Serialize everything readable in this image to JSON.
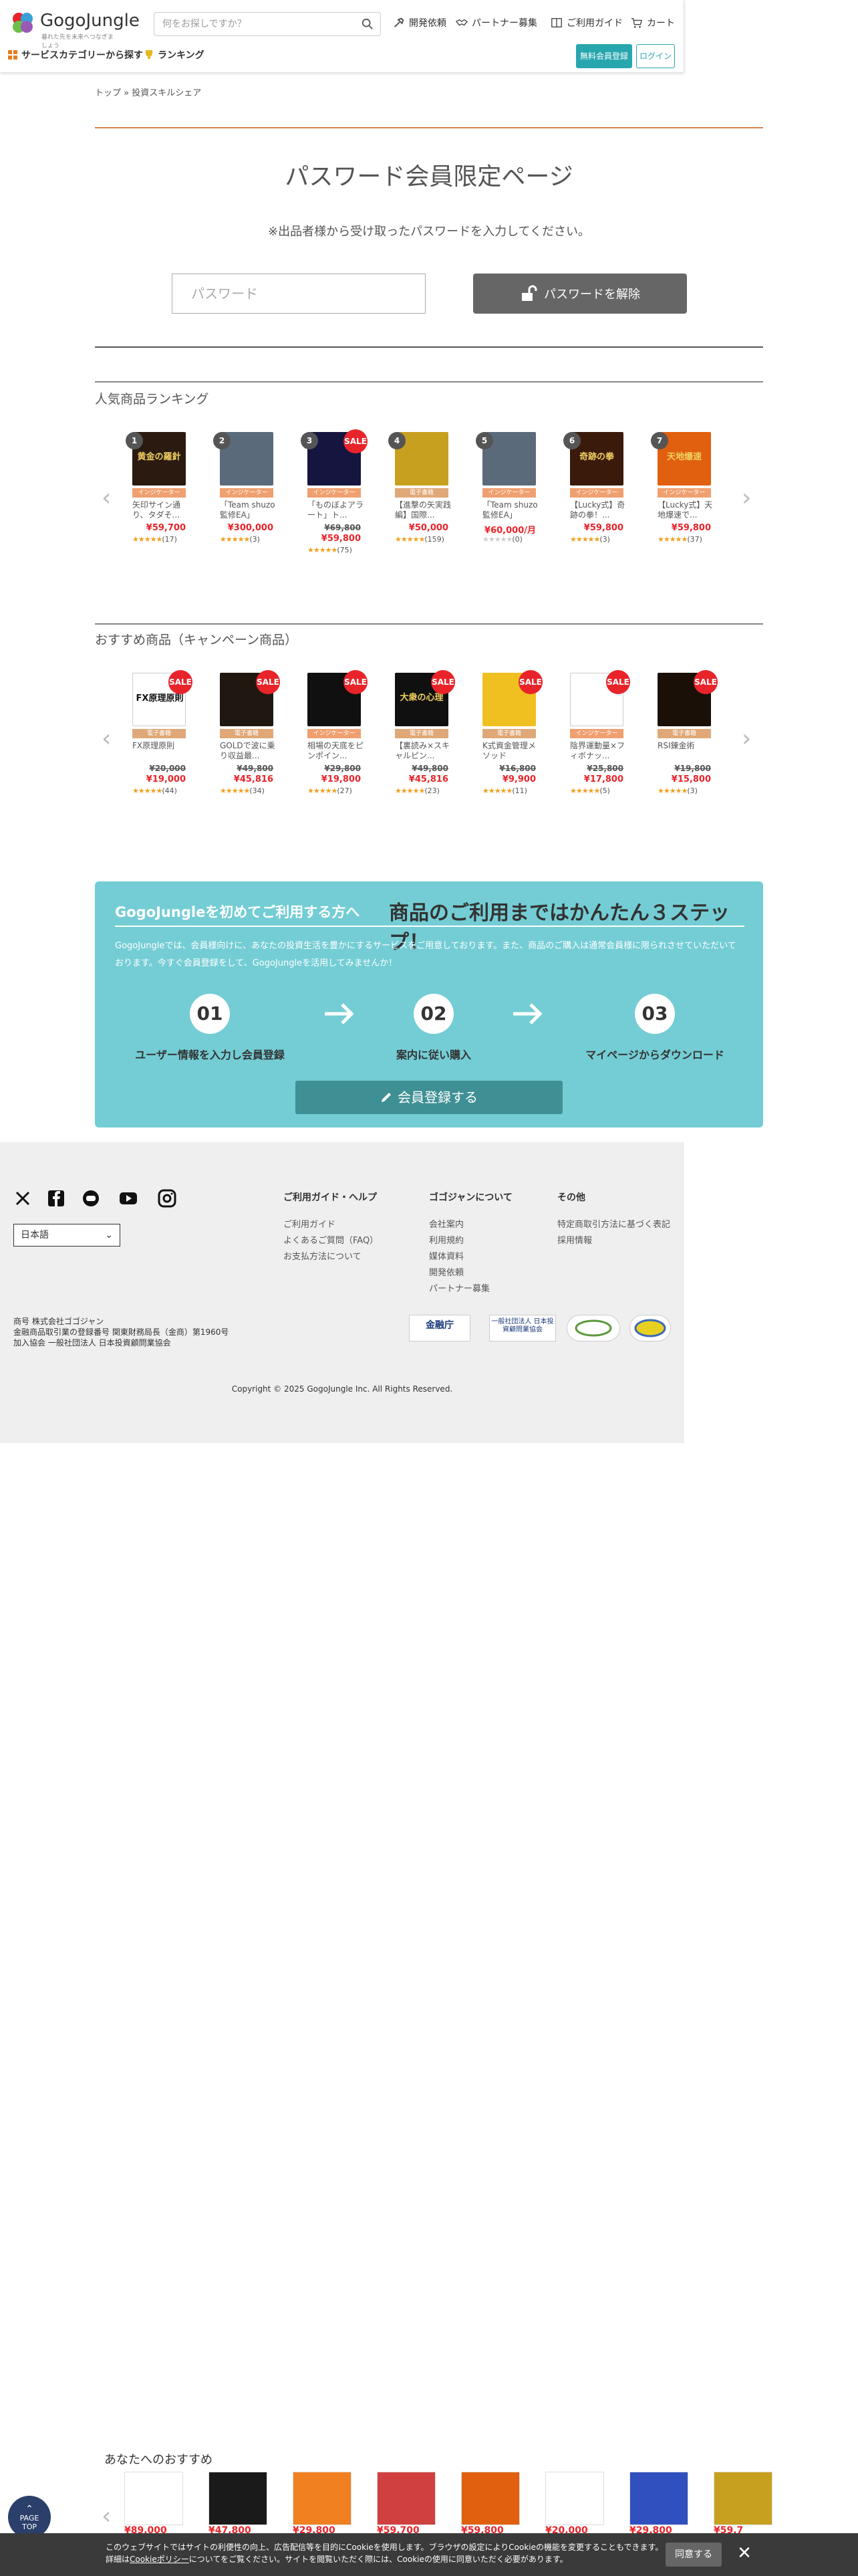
{
  "header": {
    "logo_text": "GogoJungle",
    "logo_sub": "暮れた先を未来へつなぎましょう",
    "search_placeholder": "何をお探しですか？",
    "nav": [
      "開発依頼",
      "パートナー募集",
      "ご利用ガイド",
      "カート"
    ],
    "category_label": "サービスカテゴリーから探す",
    "ranking_label": "ランキング",
    "register_label": "無料会員登録",
    "login_label": "ログイン"
  },
  "breadcrumb": "トップ » 投資スキルシェア",
  "password": {
    "title": "パスワード会員限定ページ",
    "subtitle": "※出品者様から受け取ったパスワードを入力してください。",
    "placeholder": "パスワード",
    "button": "パスワードを解除"
  },
  "ranking": {
    "title": "人気商品ランキング",
    "items": [
      {
        "rank": "1",
        "tag": "インジケーター",
        "tag_color": "#f0a070",
        "name": "矢印サイン通り、タダそ...",
        "old": "",
        "price": "¥59,700",
        "stars": 5,
        "count": "(17)",
        "sale": false,
        "img": "#2a1a10",
        "img_text": "黄金の羅針"
      },
      {
        "rank": "2",
        "tag": "インジケーター",
        "tag_color": "#f0a070",
        "name": "「Team shuzo監修EA」",
        "old": "",
        "price": "¥300,000",
        "stars": 5,
        "count": "(3)",
        "sale": false,
        "img": "#5a6a7a",
        "img_text": ""
      },
      {
        "rank": "3",
        "tag": "インジケーター",
        "tag_color": "#f0a070",
        "name": "「ものぼよアラート」ト...",
        "old": "¥69,800",
        "price": "¥59,800",
        "stars": 5,
        "count": "(75)",
        "sale": true,
        "img": "#151540",
        "img_text": ""
      },
      {
        "rank": "4",
        "tag": "電子書籍",
        "tag_color": "#f0a070",
        "name": "【進撃の矢実践編】国際...",
        "old": "",
        "price": "¥50,000",
        "stars": 5,
        "count": "(159)",
        "sale": false,
        "img": "#c8a020",
        "img_text": ""
      },
      {
        "rank": "5",
        "tag": "インジケーター",
        "tag_color": "#f0a070",
        "name": "「Team shuzo監修EA」",
        "old": "",
        "price": "¥60,000/月",
        "stars": 0,
        "count": "(0)",
        "sale": false,
        "img": "#5a6a7a",
        "img_text": ""
      },
      {
        "rank": "6",
        "tag": "インジケーター",
        "tag_color": "#f0a070",
        "name": "【Lucky式】奇跡の拳！...",
        "old": "",
        "price": "¥59,800",
        "stars": 5,
        "count": "(3)",
        "sale": false,
        "img": "#3a1a0a",
        "img_text": "奇跡の拳"
      },
      {
        "rank": "7",
        "tag": "インジケーター",
        "tag_color": "#f0a070",
        "name": "【Lucky式】天地爆速で...",
        "old": "",
        "price": "¥59,800",
        "stars": 5,
        "count": "(37)",
        "sale": false,
        "img": "#e06010",
        "img_text": "天地爆速"
      }
    ]
  },
  "campaign": {
    "title": "おすすめ商品（キャンペーン商品）",
    "items": [
      {
        "tag": "電子書籍",
        "name": "FX原理原則",
        "old": "¥20,000",
        "price": "¥19,000",
        "stars": 5,
        "count": "(44)",
        "img": "#ffffff",
        "img_text": "FX原理原則"
      },
      {
        "tag": "電子書籍",
        "name": "GOLDで波に乗り収益最...",
        "old": "¥49,800",
        "price": "¥45,816",
        "stars": 5,
        "count": "(34)",
        "img": "#201810",
        "img_text": ""
      },
      {
        "tag": "インジケーター",
        "name": "相場の天底をピンポイン...",
        "old": "¥29,800",
        "price": "¥19,800",
        "stars": 5,
        "count": "(27)",
        "img": "#101010",
        "img_text": ""
      },
      {
        "tag": "電子書籍",
        "name": "【裏読み×スキャルピン...",
        "old": "¥49,800",
        "price": "¥45,816",
        "stars": 5,
        "count": "(23)",
        "img": "#101010",
        "img_text": "大衆の心理"
      },
      {
        "tag": "電子書籍",
        "name": "K式資金管理メソッド",
        "old": "¥16,800",
        "price": "¥9,900",
        "stars": 5,
        "count": "(11)",
        "img": "#f0c020",
        "img_text": ""
      },
      {
        "tag": "インジケーター",
        "name": "陰界運動量×フィボナッ...",
        "old": "¥25,800",
        "price": "¥17,800",
        "stars": 5,
        "count": "(5)",
        "img": "#ffffff",
        "img_text": ""
      },
      {
        "tag": "電子書籍",
        "name": "RSI錬金術",
        "old": "¥19,800",
        "price": "¥15,800",
        "stars": 5,
        "count": "(3)",
        "img": "#1a1008",
        "img_text": ""
      }
    ]
  },
  "banner": {
    "heading": "GogoJungleを初めてご利用する方へ",
    "headline": "商品のご利用まではかんたん３ステップ！",
    "desc": "GogoJungleでは、会員様向けに、あなたの投資生活を豊かにするサービスをご用意しております。また、商品のご購入は通常会員様に限られさせていただいております。今すぐ会員登録をして、GogoJungleを活用してみませんか！",
    "steps": [
      {
        "num": "01",
        "label": "ユーザー情報を入力し会員登録"
      },
      {
        "num": "02",
        "label": "案内に従い購入"
      },
      {
        "num": "03",
        "label": "マイページからダウンロード"
      }
    ],
    "button": "会員登録する"
  },
  "footer": {
    "lang": "日本語",
    "col1_title": "ご利用ガイド・ヘルプ",
    "col1_links": [
      "ご利用ガイド",
      "よくあるご質問（FAQ）",
      "お支払方法について"
    ],
    "col2_title": "ゴゴジャンについて",
    "col2_links": [
      "会社案内",
      "利用規約",
      "媒体資料",
      "開発依頼",
      "パートナー募集"
    ],
    "col3_title": "その他",
    "col3_links": [
      "特定商取引方法に基づく表記",
      "採用情報"
    ],
    "company_lines": [
      "商号 株式会社ゴゴジャン",
      "金融商品取引業の登録番号 関東財務局長（金商）第1960号",
      "加入協会 一般社団法人 日本投資顧問業協会"
    ],
    "badges": [
      "金融庁",
      "一般社団法人 日本投資顧問業協会",
      "",
      ""
    ],
    "copyright": "Copyright © 2025 GogoJungle Inc. All Rights Reserved."
  },
  "recommend": {
    "title": "あなたへのおすすめ",
    "prices": [
      "¥89,000",
      "¥47,800",
      "¥29,800",
      "¥59,700",
      "¥59,800",
      "¥20,000",
      "¥29,800",
      "¥59,7"
    ]
  },
  "page_top": "PAGE TOP",
  "cookie": {
    "text1": "このウェブサイトではサイトの利便性の向上、広告配信等を目的にCookieを使用します。ブラウザの設定によりCookieの機能を変更することもできます。",
    "text2a": "詳細は",
    "policy_link": "Cookieポリシー",
    "text2b": "についてをご覧ください。サイトを閲覧いただく際には、Cookieの使用に同意いただく必要があります。",
    "accept": "同意する",
    "close": "✕"
  }
}
